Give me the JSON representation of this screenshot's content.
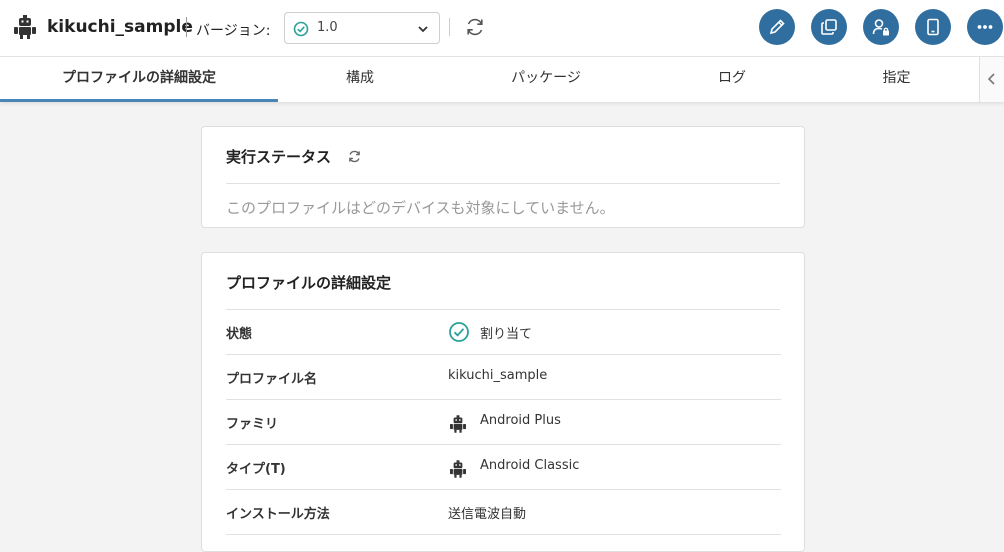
{
  "header": {
    "app_name": "kikuchi_sample",
    "app_icon": "android-icon",
    "version_label": "バージョン:",
    "version_value": "1.0",
    "accent_color": "#2f6e9e",
    "action_icons": [
      "pencil-icon",
      "copy-icon",
      "user-lock-icon",
      "tablet-icon",
      "more-icon"
    ]
  },
  "tabs": [
    {
      "label": "プロファイルの詳細設定",
      "active": true
    },
    {
      "label": "構成",
      "active": false
    },
    {
      "label": "パッケージ",
      "active": false
    },
    {
      "label": "ログ",
      "active": false
    },
    {
      "label": "指定",
      "active": false
    }
  ],
  "execution_status": {
    "title": "実行ステータス",
    "empty_message": "このプロファイルはどのデバイスも対象にしていません。"
  },
  "profile_details": {
    "title": "プロファイルの詳細設定",
    "rows": [
      {
        "label": "状態",
        "value": "割り当て",
        "icon": "check-circle-icon"
      },
      {
        "label": "プロファイル名",
        "value": "kikuchi_sample"
      },
      {
        "label": "ファミリ",
        "value": "Android Plus",
        "icon": "android-icon"
      },
      {
        "label": "タイプ(T)",
        "value": "Android Classic",
        "icon": "android-icon"
      },
      {
        "label": "インストール方法",
        "value": "送信電波自動"
      }
    ]
  }
}
